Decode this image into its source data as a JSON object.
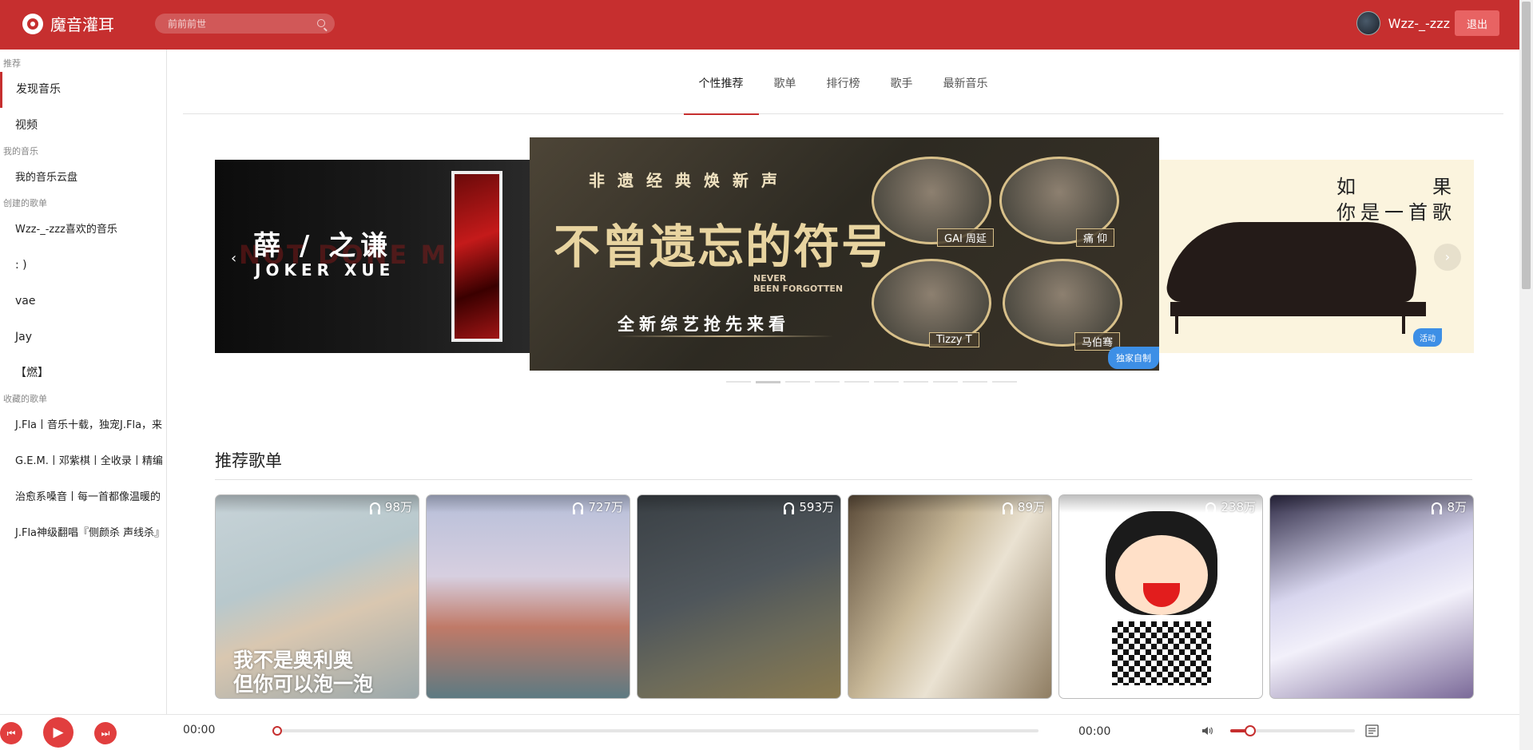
{
  "app": {
    "name": "魔音灌耳",
    "brand_color": "#c62f2f"
  },
  "search": {
    "placeholder": "前前前世",
    "icon": "search-icon"
  },
  "user": {
    "name": "Wzz-_-zzz",
    "logout_label": "退出"
  },
  "sidebar": {
    "sections": [
      {
        "title": "推荐",
        "items": [
          "发现音乐",
          "视频"
        ]
      },
      {
        "title": "我的音乐",
        "items": [
          "我的音乐云盘"
        ]
      },
      {
        "title": "创建的歌单",
        "items": [
          "Wzz-_-zzz喜欢的音乐",
          ": )",
          "vae",
          "Jay",
          "【燃】"
        ]
      },
      {
        "title": "收藏的歌单",
        "items": [
          "J.Fla丨音乐十载，独宠J.Fla，来",
          "G.E.M.丨邓紫棋丨全收录丨精编",
          "治愈系嗓音丨每一首都像温暖的",
          "J.Fla神级翻唱『侧颜杀 声线杀』"
        ]
      }
    ],
    "active": "发现音乐"
  },
  "tabs": [
    "个性推荐",
    "歌单",
    "排行榜",
    "歌手",
    "最新音乐"
  ],
  "active_tab": "个性推荐",
  "carousel": {
    "left": {
      "bg_text": "NOT DONE ME",
      "title": "薛 / 之谦",
      "subtitle": "JOKER XUE"
    },
    "center": {
      "top": "非遗经典焕新声",
      "main": "不曾遗忘的符号",
      "en1": "NEVER",
      "en2": "BEEN FORGOTTEN",
      "sub": "全新综艺抢先来看",
      "portraits": [
        "GAI 周延",
        "痛 仰",
        "Tizzy T",
        "马伯骞"
      ],
      "badge": "独家自制"
    },
    "right": {
      "line1": "如　　　果",
      "line2": "你是一首歌",
      "badge": "活动"
    },
    "dot_count": 10,
    "active_dot": 1
  },
  "recommend": {
    "title": "推荐歌单",
    "cards": [
      {
        "count": "98万",
        "caption1": "我不是奥利奥",
        "caption2": "但你可以泡一泡"
      },
      {
        "count": "727万"
      },
      {
        "count": "593万"
      },
      {
        "count": "89万"
      },
      {
        "count": "238万"
      },
      {
        "count": "8万"
      }
    ]
  },
  "player": {
    "current_time": "00:00",
    "total_time": "00:00",
    "progress": 0,
    "volume": 0.16,
    "icons": [
      "prev-icon",
      "play-icon",
      "next-icon",
      "volume-icon",
      "playlist-icon"
    ]
  }
}
